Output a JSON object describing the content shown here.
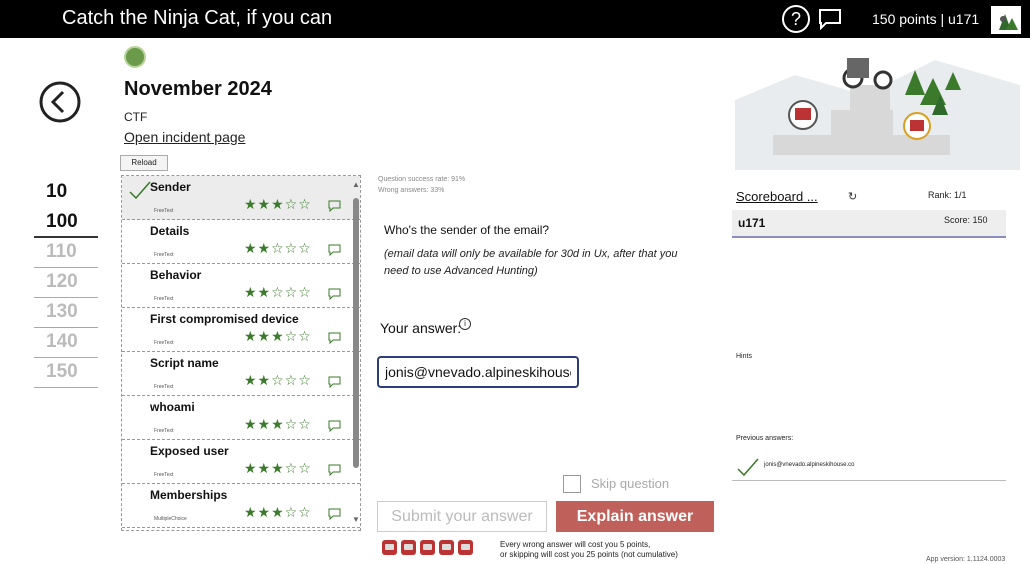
{
  "header": {
    "title": "Catch the Ninja Cat, if you can",
    "points_label": "150 points | u171",
    "help_symbol": "?"
  },
  "incident": {
    "month": "November 2024",
    "category": "CTF",
    "open_link": "Open incident page",
    "reload": "Reload"
  },
  "levels": [
    {
      "label": "10",
      "state": "done"
    },
    {
      "label": "100",
      "state": "active"
    },
    {
      "label": "110",
      "state": "locked"
    },
    {
      "label": "120",
      "state": "locked"
    },
    {
      "label": "130",
      "state": "locked"
    },
    {
      "label": "140",
      "state": "locked"
    },
    {
      "label": "150",
      "state": "locked"
    }
  ],
  "questions": [
    {
      "name": "Sender",
      "type": "FreeText",
      "stars": "★★★☆☆",
      "rating": 3,
      "answered": true,
      "selected": true
    },
    {
      "name": "Details",
      "type": "FreeText",
      "stars": "★★☆☆☆",
      "rating": 2
    },
    {
      "name": "Behavior",
      "type": "FreeText",
      "stars": "★★☆☆☆",
      "rating": 2
    },
    {
      "name": "First compromised device",
      "type": "FreeText",
      "stars": "★★★☆☆",
      "rating": 3
    },
    {
      "name": "Script name",
      "type": "FreeText",
      "stars": "★★☆☆☆",
      "rating": 2
    },
    {
      "name": "whoami",
      "type": "FreeText",
      "stars": "★★★☆☆",
      "rating": 3
    },
    {
      "name": "Exposed user",
      "type": "FreeText",
      "stars": "★★★☆☆",
      "rating": 3
    },
    {
      "name": "Memberships",
      "type": "MultipleChoice",
      "stars": "★★★☆☆",
      "rating": 3
    }
  ],
  "question_panel": {
    "success_rate": "Question success rate: 91%",
    "wrong_answers": "Wrong answers: 33%",
    "question": "Who's the sender of the email?",
    "note": "(email data will only be available for 30d in Ux, after that you need to use Advanced Hunting)",
    "your_answer_label": "Your answer:",
    "answer_value": "jonis@vnevado.alpineskihouse.co",
    "skip_label": "Skip question",
    "submit_label": "Submit your answer",
    "explain_label": "Explain answer",
    "lives_count": 5,
    "penalty_line1": "Every wrong answer will cost you 5 points,",
    "penalty_line2": "or skipping will cost you 25 points (not cumulative)"
  },
  "scoreboard": {
    "link_label": "Scoreboard ...",
    "refresh_icon": "refresh-icon",
    "rank": "Rank: 1/1",
    "user": "u171",
    "score": "Score: 150",
    "hints_label": "Hints",
    "previous_label": "Previous answers:",
    "previous_answer": "jonis@vnevado.alpineskihouse.co"
  },
  "app_version": "App version: 1.1124.0003",
  "colors": {
    "accent_green": "#3a7a2a",
    "explain_red": "#c0605a",
    "input_border": "#2c3d7a",
    "topbar": "#000000"
  }
}
